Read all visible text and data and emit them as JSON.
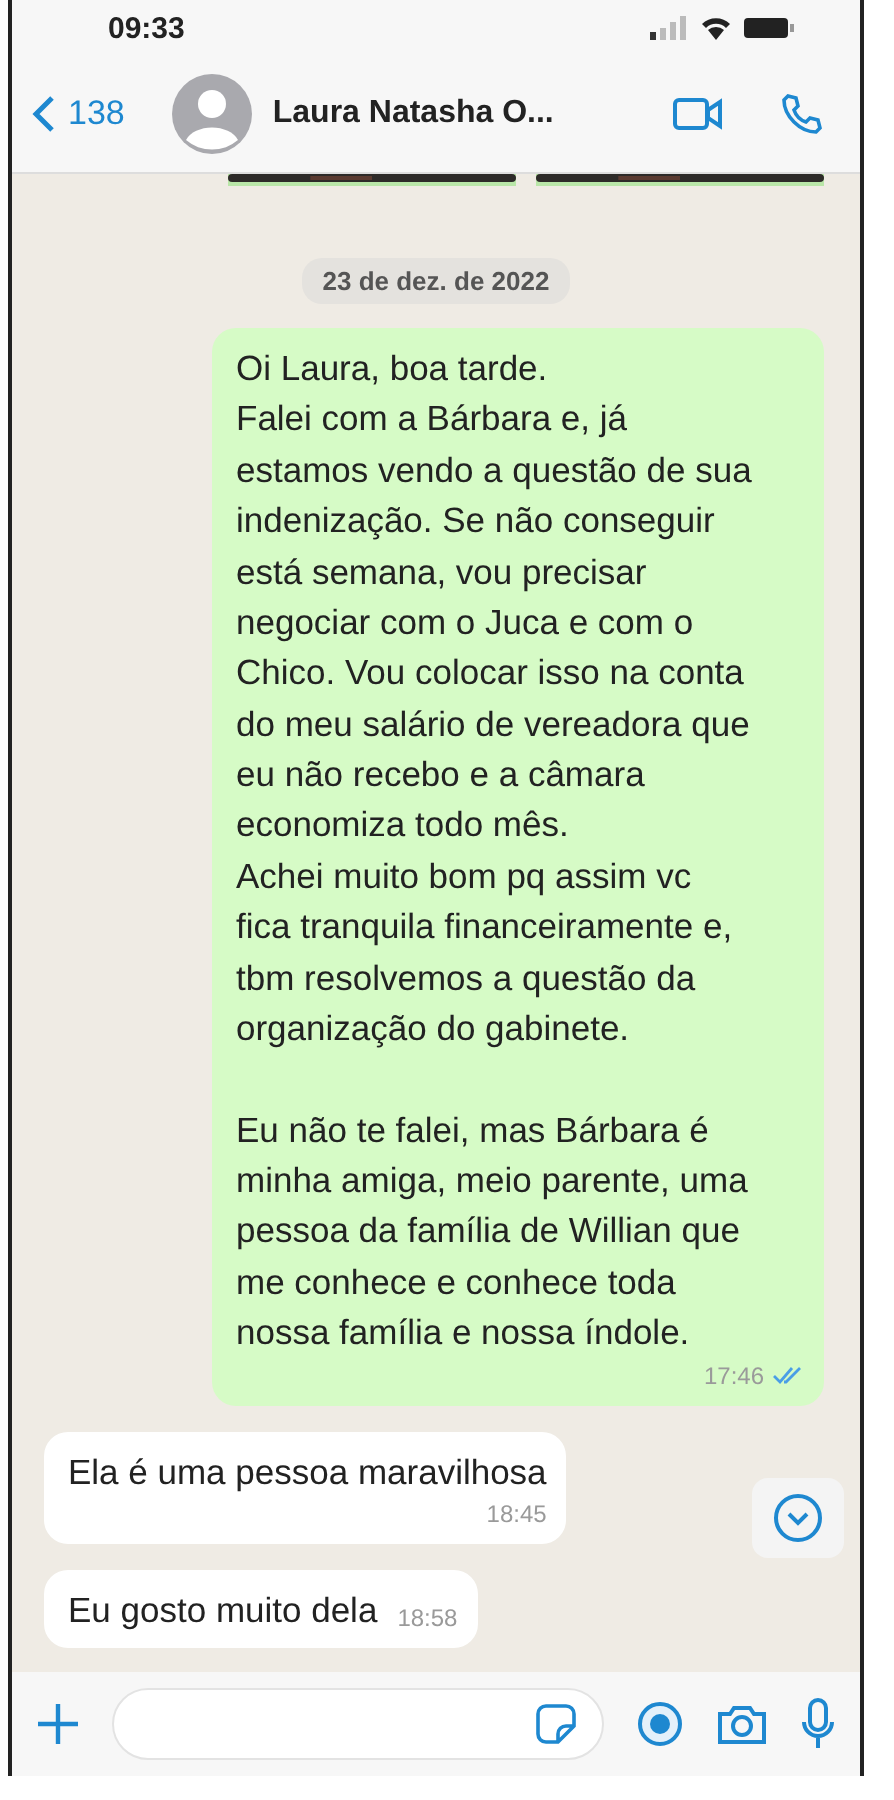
{
  "status_bar": {
    "time": "09:33"
  },
  "header": {
    "back_count": "138",
    "contact_name": "Laura Natasha O..."
  },
  "date_separator": "23 de dez. de 2022",
  "messages": [
    {
      "kind": "outgoing",
      "text": "Oi Laura, boa tarde.\nFalei com a Bárbara e, já\nestamos vendo a questão de sua\nindenização.  Se não conseguir\nestá semana, vou precisar\nnegociar com o Juca e com o\nChico. Vou colocar isso na conta\ndo meu salário de vereadora que\neu não recebo e a câmara\neconomiza todo mês.\nAchei muito bom pq assim vc\nfica tranquila financeiramente e,\ntbm resolvemos a questão da\norganização do gabinete.\n\nEu não te falei, mas Bárbara é\nminha amiga, meio parente, uma\npessoa da família de Willian que\nme conhece e conhece toda\nnossa família e nossa índole.",
      "time": "17:46",
      "read": true
    },
    {
      "kind": "incoming",
      "text": "Ela é uma pessoa maravilhosa",
      "time": "18:45",
      "time_below": true
    },
    {
      "kind": "incoming",
      "text": "Eu gosto muito dela",
      "time": "18:58",
      "time_below": false
    }
  ]
}
